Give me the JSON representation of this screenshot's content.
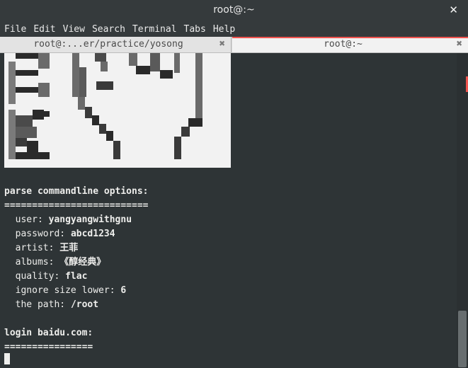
{
  "window": {
    "title": "root@:~"
  },
  "menu": [
    "File",
    "Edit",
    "View",
    "Search",
    "Terminal",
    "Tabs",
    "Help"
  ],
  "tabs": [
    {
      "label": "root@:...er/practice/yosong",
      "active": false
    },
    {
      "label": "root@:~",
      "active": true
    }
  ],
  "terminal": {
    "section1_header": "parse commandline options:",
    "section1_rule": "==========================",
    "options": [
      {
        "label": "user:",
        "value": "yangyangwithgnu"
      },
      {
        "label": "password:",
        "value": "abcd1234"
      },
      {
        "label": "artist:",
        "value": "王菲"
      },
      {
        "label": "albums:",
        "value": "《醇经典》"
      },
      {
        "label": "quality:",
        "value": "flac"
      },
      {
        "label": "ignore size lower:",
        "value": "6"
      },
      {
        "label": "the path:",
        "value": "/root"
      }
    ],
    "section2_header": "login baidu.com:",
    "section2_rule": "================"
  },
  "colors": {
    "terminal_bg": "#2e3436",
    "terminal_fg": "#eeeeec",
    "active_tab_accent": "#f0544f"
  },
  "icons": {
    "tab_close": "close-icon",
    "window_close": "close-icon"
  }
}
